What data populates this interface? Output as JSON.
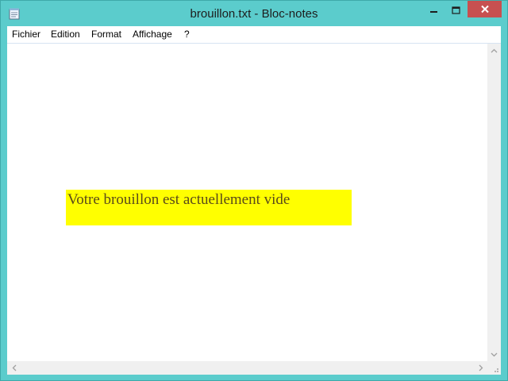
{
  "window": {
    "title": "brouillon.txt - Bloc-notes"
  },
  "menu": {
    "items": [
      {
        "label": "Fichier"
      },
      {
        "label": "Edition"
      },
      {
        "label": "Format"
      },
      {
        "label": "Affichage"
      },
      {
        "label": "?"
      }
    ]
  },
  "document": {
    "banner_text": "Votre brouillon est actuellement vide",
    "banner_color": "#ffff00"
  },
  "icons": {
    "app": "notepad-icon",
    "minimize": "minimize-icon",
    "maximize": "maximize-icon",
    "close": "close-icon"
  },
  "colors": {
    "frame": "#5bcccc",
    "close_button": "#c75050"
  }
}
